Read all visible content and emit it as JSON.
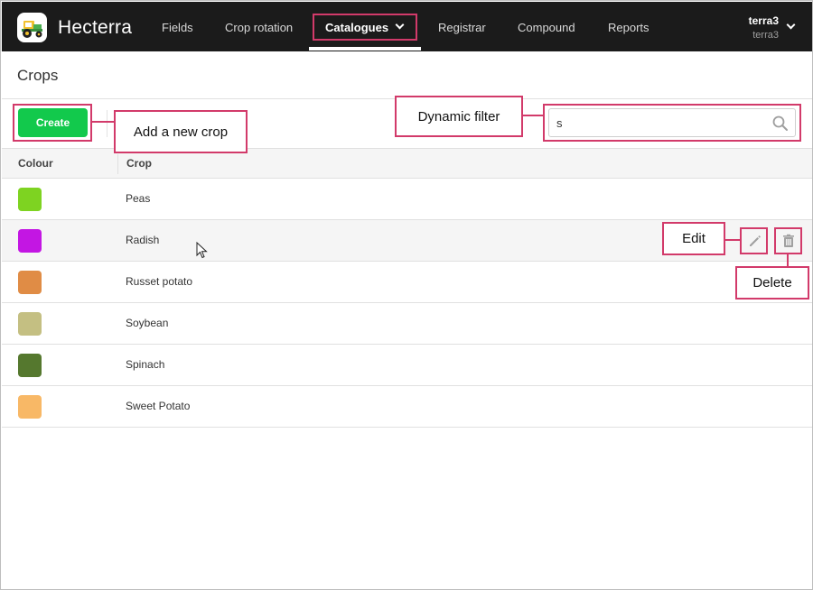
{
  "app": {
    "name": "Hecterra"
  },
  "nav": {
    "items": [
      {
        "label": "Fields"
      },
      {
        "label": "Crop rotation"
      },
      {
        "label": "Catalogues",
        "active": true
      },
      {
        "label": "Registrar"
      },
      {
        "label": "Compound"
      },
      {
        "label": "Reports"
      }
    ]
  },
  "user": {
    "name": "terra3",
    "account": "terra3"
  },
  "page": {
    "title": "Crops"
  },
  "toolbar": {
    "create_label": "Create"
  },
  "search": {
    "value": "s",
    "placeholder": ""
  },
  "table": {
    "headers": {
      "colour": "Colour",
      "crop": "Crop"
    },
    "rows": [
      {
        "name": "Peas",
        "color": "#7ed321"
      },
      {
        "name": "Radish",
        "color": "#c316e3"
      },
      {
        "name": "Russet potato",
        "color": "#e08c45"
      },
      {
        "name": "Soybean",
        "color": "#c4bf82"
      },
      {
        "name": "Spinach",
        "color": "#55782e"
      },
      {
        "name": "Sweet Potato",
        "color": "#f8b866"
      }
    ]
  },
  "annotations": {
    "add_crop": "Add a new crop",
    "dynamic_filter": "Dynamic filter",
    "edit": "Edit",
    "delete": "Delete"
  },
  "colors": {
    "accent": "#12c94c",
    "topbar": "#1b1b1b",
    "callout": "#d23a6a"
  },
  "icons": {
    "logo": "tractor-logo-icon",
    "search": "search-icon",
    "edit": "pencil-icon",
    "delete": "trash-icon",
    "dropdown": "chevron-down-icon"
  }
}
